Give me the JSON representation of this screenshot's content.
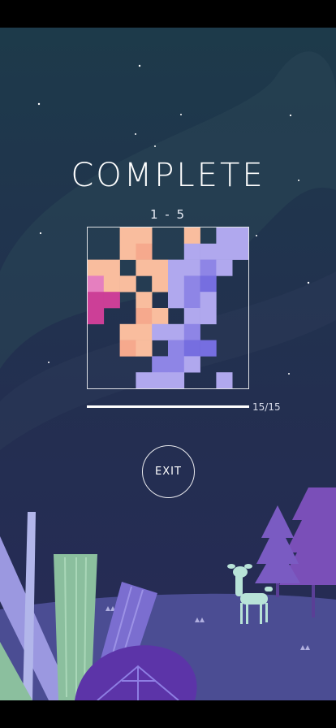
{
  "screen": {
    "title": "COMPLETE",
    "level": "1 - 5",
    "progress_label": "15/15",
    "progress": {
      "current": 15,
      "total": 15
    },
    "exit_label": "EXIT"
  },
  "colors": {
    "background_top": "#1d3a4a",
    "background_bottom": "#272a57",
    "peach": "#f9bd9e",
    "salmon": "#f6a98d",
    "pink": "#e57fbf",
    "magenta": "#cc3f97",
    "lavender": "#b0a8ee",
    "violet": "#8e85e6",
    "indigo": "#766ee0"
  },
  "puzzle": {
    "size": 10,
    "rows": [
      "..PP..P.LL",
      "..PS..LLLL",
      "PP.PPLLVL.",
      "KPP.PLVI..",
      "MM.P.LVL..",
      "M..SP.LL..",
      "..PPLLV...",
      "..SP.VII..",
      "....VVL...",
      "...LLL..L."
    ]
  }
}
